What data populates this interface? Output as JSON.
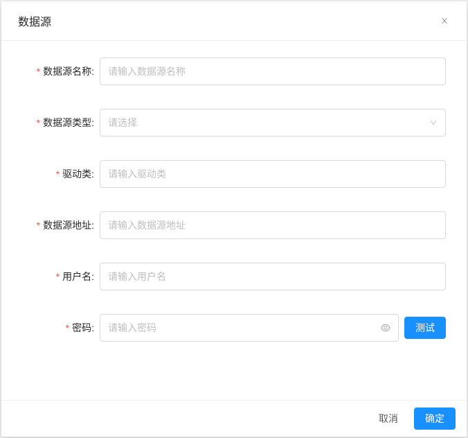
{
  "modal": {
    "title": "数据源"
  },
  "form": {
    "name": {
      "label": "数据源名称:",
      "placeholder": "请输入数据源名称"
    },
    "type": {
      "label": "数据源类型:",
      "placeholder": "请选择"
    },
    "driver": {
      "label": "驱动类:",
      "placeholder": "请输入驱动类"
    },
    "url": {
      "label": "数据源地址:",
      "placeholder": "请输入数据源地址"
    },
    "username": {
      "label": "用户名:",
      "placeholder": "请输入用户名"
    },
    "password": {
      "label": "密码:",
      "placeholder": "请输入密码"
    }
  },
  "buttons": {
    "test": "测试",
    "cancel": "取消",
    "confirm": "确定"
  }
}
